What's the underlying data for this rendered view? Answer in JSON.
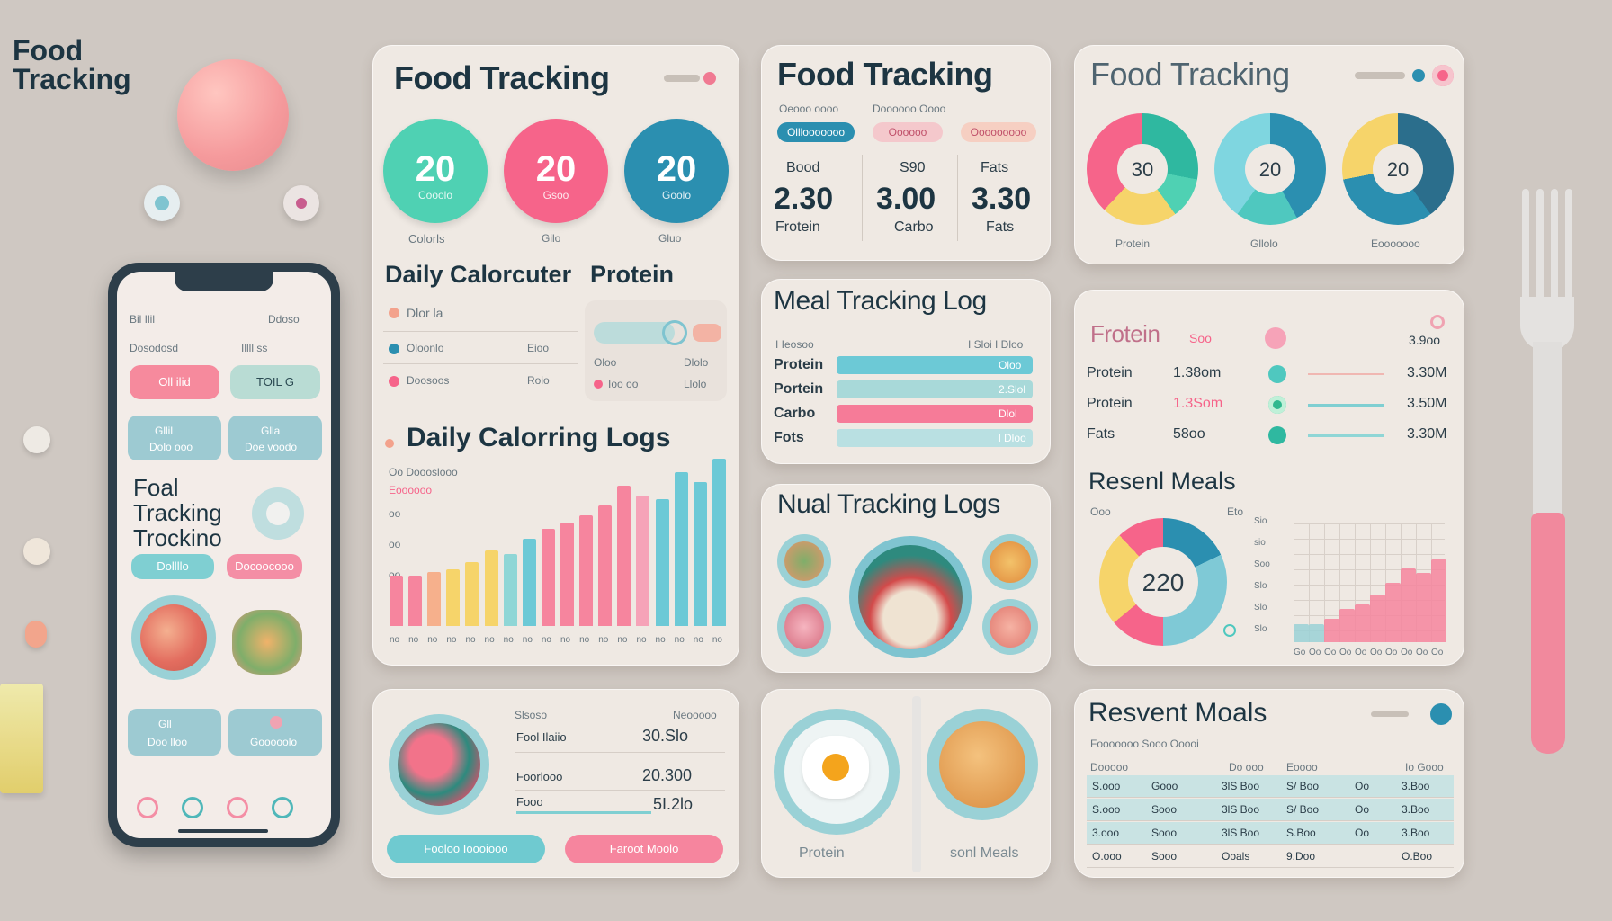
{
  "brand": {
    "line1": "Food",
    "line2": "Tracking"
  },
  "phone": {
    "status_left": "Bil Ilil",
    "status_right": "Ddoso",
    "header_left": "Dosodosd",
    "header_right": "Illll ss",
    "btn1": "Oll ilid",
    "btn2": "TOIL G",
    "card1_top": "Gllil",
    "card1_bottom": "Dolo ooo",
    "card2_top": "Glla",
    "card2_bottom": "Doe voodo",
    "title_l1": "Foal",
    "title_l2": "Tracking",
    "title_l3": "Trockino",
    "pill1": "Dollllo",
    "pill2": "Docoocooo",
    "bot1_top": "Gll",
    "bot1_bottom": "Doo lloo",
    "bot2_bottom": "Gooooolo"
  },
  "card_food_main": {
    "title": "Food Tracking",
    "circles": [
      {
        "value": "20",
        "label": "Cooolo",
        "color": "#4fd1b3"
      },
      {
        "value": "20",
        "label": "Gsoo",
        "color": "#f6648a"
      },
      {
        "value": "20",
        "label": "Goolo",
        "color": "#2b8fb0"
      }
    ],
    "circle_labels": [
      "Colorls",
      "Gilo",
      "Gluo"
    ],
    "daily_title": "Daily Calorcuter",
    "protein_title": "Protein",
    "daily_rows": [
      {
        "left": "Dlor la",
        "right": ""
      },
      {
        "left": "Oloonlo",
        "right": "Eioo"
      },
      {
        "left": "Doosoos",
        "right": "Roio"
      }
    ],
    "protein_rows": [
      {
        "left": "Oloo",
        "right": "Dlolo"
      },
      {
        "left": "Ioo oo",
        "right": "Llolo"
      }
    ],
    "logs_title": "Daily Calorring Logs",
    "logs_legend1": "Oo Doooslooo",
    "logs_legend2": "Eoooooo",
    "logs_y_ticks": [
      "oo",
      "oo",
      "oo"
    ],
    "logs_x_ticks": [
      "no",
      "no",
      "no",
      "no",
      "no",
      "no",
      "no",
      "no",
      "no",
      "no",
      "no",
      "no",
      "no",
      "no",
      "no",
      "no",
      "no",
      "no"
    ]
  },
  "card_food_center": {
    "title": "Food Tracking",
    "tabs": [
      "Oeooo oooo",
      "Doooooo",
      "Oooo"
    ],
    "pills": [
      "Olllooooooo",
      "Oooooo",
      "Ooooooooo"
    ],
    "cols": [
      {
        "top": "Bood",
        "value": "2.30",
        "label": "Frotein"
      },
      {
        "top": "S90",
        "value": "3.00",
        "label": "Carbo"
      },
      {
        "top": "Fats",
        "value": "3.30",
        "label": "Fats"
      }
    ]
  },
  "card_food_right": {
    "title": "Food Tracking",
    "donuts": [
      {
        "value": "30",
        "label": "Protein"
      },
      {
        "value": "20",
        "label": "Gllolo"
      },
      {
        "value": "20",
        "label": "Eooooooo"
      }
    ]
  },
  "meal_log": {
    "title": "Meal Tracking Log",
    "header_left": "I Ieosoo",
    "header_right": "I Sloi I Dloo",
    "rows": [
      {
        "label": "Protein",
        "value": "Oloo",
        "pct": 0.98,
        "color": "#6cc9d6"
      },
      {
        "label": "Portein",
        "value": "2.Slol",
        "pct": 0.98,
        "color": "#a8d9d9"
      },
      {
        "label": "Carbo",
        "value": "Dlol",
        "pct": 0.98,
        "color": "#f67b98"
      },
      {
        "label": "Fots",
        "value": "l Dloo",
        "pct": 0.98,
        "color": "#b9e0e2"
      }
    ]
  },
  "meal_logs_photo": {
    "title": "Nual Tracking Logs"
  },
  "macro_card": {
    "title": "Frotein",
    "title_badge": "Soo",
    "head_right": "3.9oo",
    "rows": [
      {
        "label": "Protein",
        "value": "1.38om",
        "right": "3.30M"
      },
      {
        "label": "Protein",
        "value": "1.3Som",
        "right": "3.50M"
      },
      {
        "label": "Fats",
        "value": "58oo",
        "right": "3.30M"
      }
    ],
    "recent_title": "Resenl Meals",
    "recent_left_tick": "Ooo",
    "recent_right_tick": "Eto",
    "donut_value": "220",
    "bar_y_ticks": [
      "Sio",
      "sio",
      "Soo",
      "Slo",
      "Slo",
      "Slo"
    ],
    "bar_x_ticks": [
      "Go",
      "Oo",
      "Oo",
      "Oo",
      "Oo",
      "Oo",
      "Oo",
      "Oo",
      "Oo",
      "Oo"
    ]
  },
  "bottom_left": {
    "col_left": "Slsoso",
    "col_right": "Neooooo",
    "rows": [
      {
        "label": "Fool Ilaiio",
        "value": "30.Slo"
      },
      {
        "label": "Foorlooo",
        "value": "20.300"
      },
      {
        "label": "Fooo",
        "value": "5I.2lo"
      }
    ],
    "btn1": "Fooloo Ioooiooo",
    "btn2": "Faroot Moolo"
  },
  "plate_card": {
    "left_label": "Protein",
    "right_label": "sonl Meals"
  },
  "recent_meals": {
    "title": "Resvent Moals",
    "subtitle": "Fooooooo Sooo Ooooi",
    "headers": [
      "Dooooo",
      "Do ooo",
      "Eoooo",
      "Io Gooo"
    ],
    "rows": [
      [
        "S.ooo",
        "Gooo",
        "3lS Boo",
        "S/ Boo",
        "Oo",
        "3.Boo"
      ],
      [
        "S.ooo",
        "Sooo",
        "3lS Boo",
        "S/ Boo",
        "Oo",
        "3.Boo"
      ],
      [
        "3.ooo",
        "Sooo",
        "3lS Boo",
        "S.Boo",
        "Oo",
        "3.Boo"
      ],
      [
        "O.ooo",
        "Sooo",
        "Ooals",
        "9.Doo",
        "",
        "O.Boo"
      ]
    ]
  },
  "colors": {
    "teal": "#4fc8bf",
    "pink": "#f6648a",
    "blue": "#2b8fb0",
    "yellow": "#f6d46a",
    "bg": "#cfc8c2",
    "card": "#efe9e3"
  }
}
